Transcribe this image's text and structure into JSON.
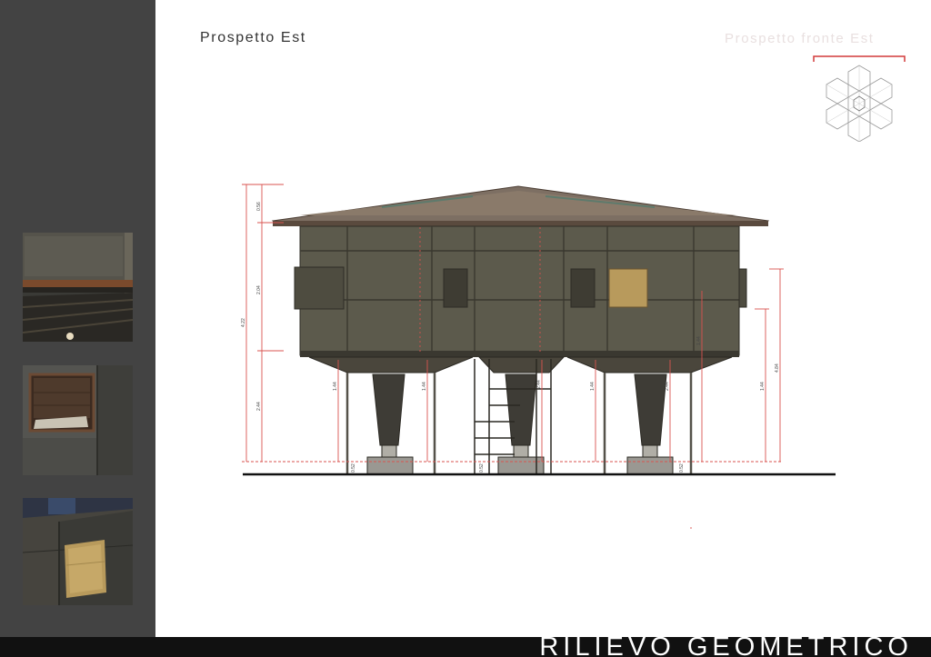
{
  "header": {
    "title": "Prospetto Est",
    "ghost_title": "Prospetto fronte Est"
  },
  "footer": {
    "title": "RILIEVO GEOMETRICO"
  },
  "sidebar": {
    "photos": [
      {
        "subject": "roof-eave-detail"
      },
      {
        "subject": "window-panel-detail"
      },
      {
        "subject": "osb-panel-detail"
      }
    ]
  },
  "dimensions": {
    "left": {
      "overall": "4.22",
      "segments": [
        "0.56",
        "2.04",
        "2.44"
      ]
    },
    "columns": [
      "1.44",
      "1.44",
      "2.44",
      "1.44",
      "2.44",
      "1.44"
    ],
    "right": {
      "overall": "4.84",
      "inner": "1.44"
    },
    "bases": [
      "0.52",
      "0.52",
      "0.52"
    ]
  },
  "colors": {
    "sidebar": "#434343",
    "dimension_lines": "#d9534f",
    "ground_line": "#111111",
    "cladding": "#5c5a4c",
    "roof": "#7d6f63"
  }
}
